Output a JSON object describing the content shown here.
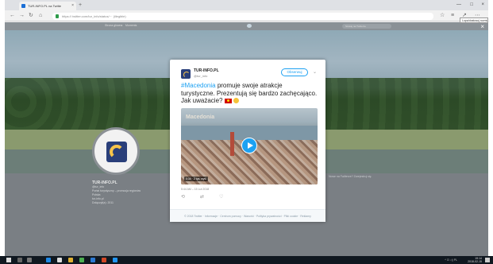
{
  "browser": {
    "tab": {
      "title": "TUR-INFO.PL na Twitte"
    },
    "address": {
      "host_visible": "twitter.com",
      "url_display": "https:// twitter.com/tur_info/status/··· (illegible)"
    },
    "tooltip": "Lupa/dostosuj rozmiar tekstu"
  },
  "twitter_nav": {
    "home": "Strona główna",
    "moments": "Moments",
    "search_placeholder": "Szukaj na Twitterze"
  },
  "profile": {
    "name": "TUR-INFO.PL",
    "handle": "@tur_info",
    "bio": "Portal turystyczny – promocja regionów",
    "meta": [
      "Polska",
      "tur-info.pl",
      "Dołączył(a): 2011"
    ]
  },
  "sidebar_right": {
    "text": "Nowe na Twitterze? Zarejestruj się"
  },
  "tweet": {
    "account_name": "TUR-INFO.PL",
    "account_handle": "@tur_info",
    "follow_label": "Obserwuj",
    "hashtag": "#Macedonia",
    "text": " promuje swoje atrakcje turystyczne. Prezentują się bardzo zachęcająco. Jak uważacie? ",
    "video_watermark": "Macedonia",
    "duration": "0:30 · 2 tys. wyś.",
    "time": "5:44 AM – 15 Lut 2018",
    "actions": {
      "reply": "⟲",
      "retweet": "⇄",
      "like": "♡"
    }
  },
  "modal_footer": "© 2018 Twitter · Informacje · Centrum pomocy · Warunki · Polityka prywatności · Pliki cookie · Reklamy",
  "taskbar": {
    "time": "19:14",
    "date": "2018-02-15",
    "tray": "^ ⊡ ◁) PL"
  },
  "colors": {
    "twitter_blue": "#1da1f2",
    "brand_navy": "#2a3f7a",
    "brand_yellow": "#f7c44a"
  }
}
